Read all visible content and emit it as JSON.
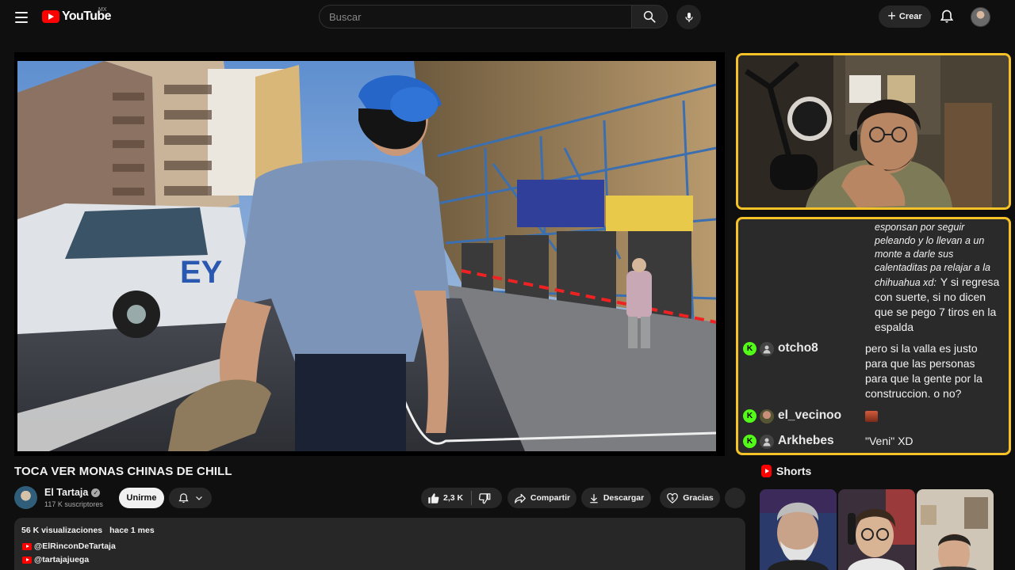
{
  "header": {
    "logo_text": "YouTube",
    "country": "MX",
    "search_placeholder": "Buscar",
    "create_label": "Crear"
  },
  "overlay": {
    "chat": {
      "continuation_italic": [
        "esponsan por seguir",
        "peleando y lo llevan a un",
        "monte a darle sus",
        "calentaditas pa relajar a la",
        "chihuahua xd:"
      ],
      "continuation_text_inline": "Y si regresa",
      "continuation_text": [
        "con suerte, si no dicen",
        "que se pego 7 tiros en la",
        "espalda"
      ],
      "messages": [
        {
          "username": "otcho8",
          "lines": [
            "pero si la valla es justo",
            "para que las personas",
            "para que la gente por la",
            "construccion. o no?"
          ]
        },
        {
          "username": "el_vecinoo",
          "emote": "emote"
        },
        {
          "username": "Arkhebes",
          "lines": [
            "\"Veni\" XD"
          ]
        }
      ],
      "badge_letter": "K"
    }
  },
  "video": {
    "title": "TOCA VER MONAS CHINAS DE CHILL"
  },
  "channel": {
    "name": "El Tartaja",
    "subscribers": "117 K suscriptores",
    "join_label": "Unirme"
  },
  "actions": {
    "likes": "2,3 K",
    "share": "Compartir",
    "download": "Descargar",
    "thanks": "Gracias"
  },
  "description": {
    "views": "56 K visualizaciones",
    "date": "hace 1 mes",
    "links": [
      "@ElRinconDeTartaja",
      "@tartajajuega"
    ]
  },
  "sidebar": {
    "shorts_title": "Shorts"
  },
  "colors": {
    "overlay_border": "#f5c228",
    "kick_badge": "#53fc18",
    "brand_red": "#ff0000",
    "bg": "#0f0f0f"
  }
}
